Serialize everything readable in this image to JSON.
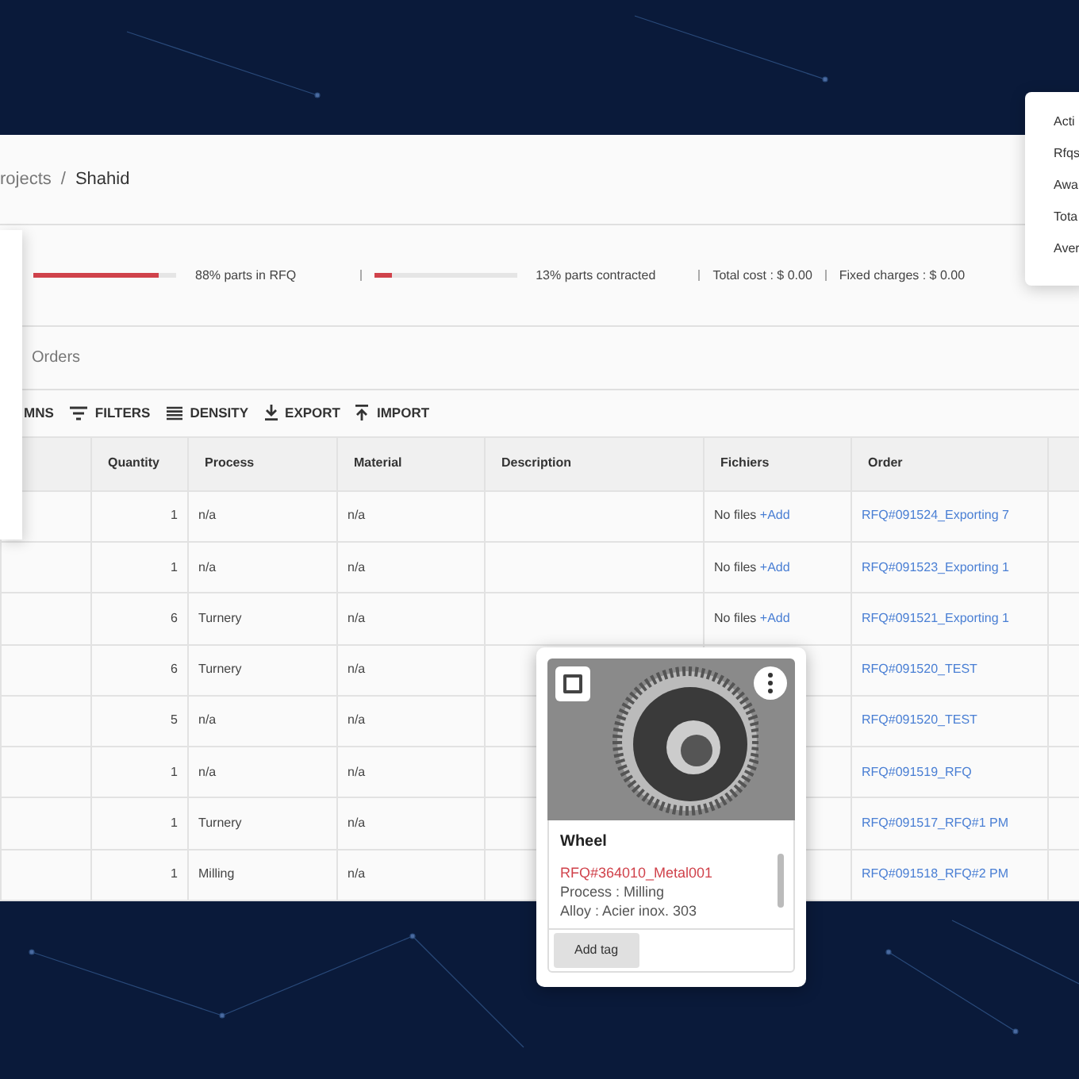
{
  "breadcrumb": {
    "parent": "rojects",
    "separator": "/",
    "current": "Shahid"
  },
  "stats": [
    {
      "level": 0.88,
      "label": "88% parts in RFQ"
    },
    {
      "level": 0.13,
      "label": "13% parts contracted"
    }
  ],
  "costs": [
    "Total cost : $ 0.00",
    "Fixed charges : $ 0.00"
  ],
  "tabs": [
    {
      "label": "Orders",
      "selected": false
    }
  ],
  "toolbar": [
    "MNS",
    "FILTERS",
    "DENSITY",
    "EXPORT",
    "IMPORT"
  ],
  "table": {
    "columns": [
      "",
      "Quantity",
      "Process",
      "Material",
      "Description",
      "Fichiers",
      "Order",
      ""
    ],
    "rows": [
      {
        "quantity": "1",
        "process": "n/a",
        "material": "n/a",
        "files": "No files",
        "add": "+Add",
        "order": "RFQ#091524_Exporting 7"
      },
      {
        "quantity": "1",
        "process": "n/a",
        "material": "n/a",
        "files": "No files",
        "add": "+Add",
        "order": "RFQ#091523_Exporting 1"
      },
      {
        "quantity": "6",
        "process": "Turnery",
        "material": "n/a",
        "files": "No files",
        "add": "+Add",
        "order": "RFQ#091521_Exporting 1"
      },
      {
        "quantity": "6",
        "process": "Turnery",
        "material": "n/a",
        "order": "RFQ#091520_TEST"
      },
      {
        "quantity": "5",
        "process": "n/a",
        "material": "n/a",
        "order": "RFQ#091520_TEST"
      },
      {
        "quantity": "1",
        "process": "n/a",
        "material": "n/a",
        "order": "RFQ#091519_RFQ"
      },
      {
        "quantity": "1",
        "process": "Turnery",
        "material": "n/a",
        "order": "RFQ#091517_RFQ#1 PM"
      },
      {
        "quantity": "1",
        "process": "Milling",
        "material": "n/a",
        "order": "RFQ#091518_RFQ#2 PM"
      }
    ]
  },
  "right_menu": [
    "Acti",
    "Rfqs",
    "Awa",
    "Tota",
    "Aver"
  ],
  "part_card": {
    "checked": false,
    "title": "Wheel",
    "reference": "RFQ#364010_Metal001",
    "lines": [
      "Process : Milling",
      "Alloy : Acier inox. 303"
    ],
    "button": "Add tag"
  }
}
